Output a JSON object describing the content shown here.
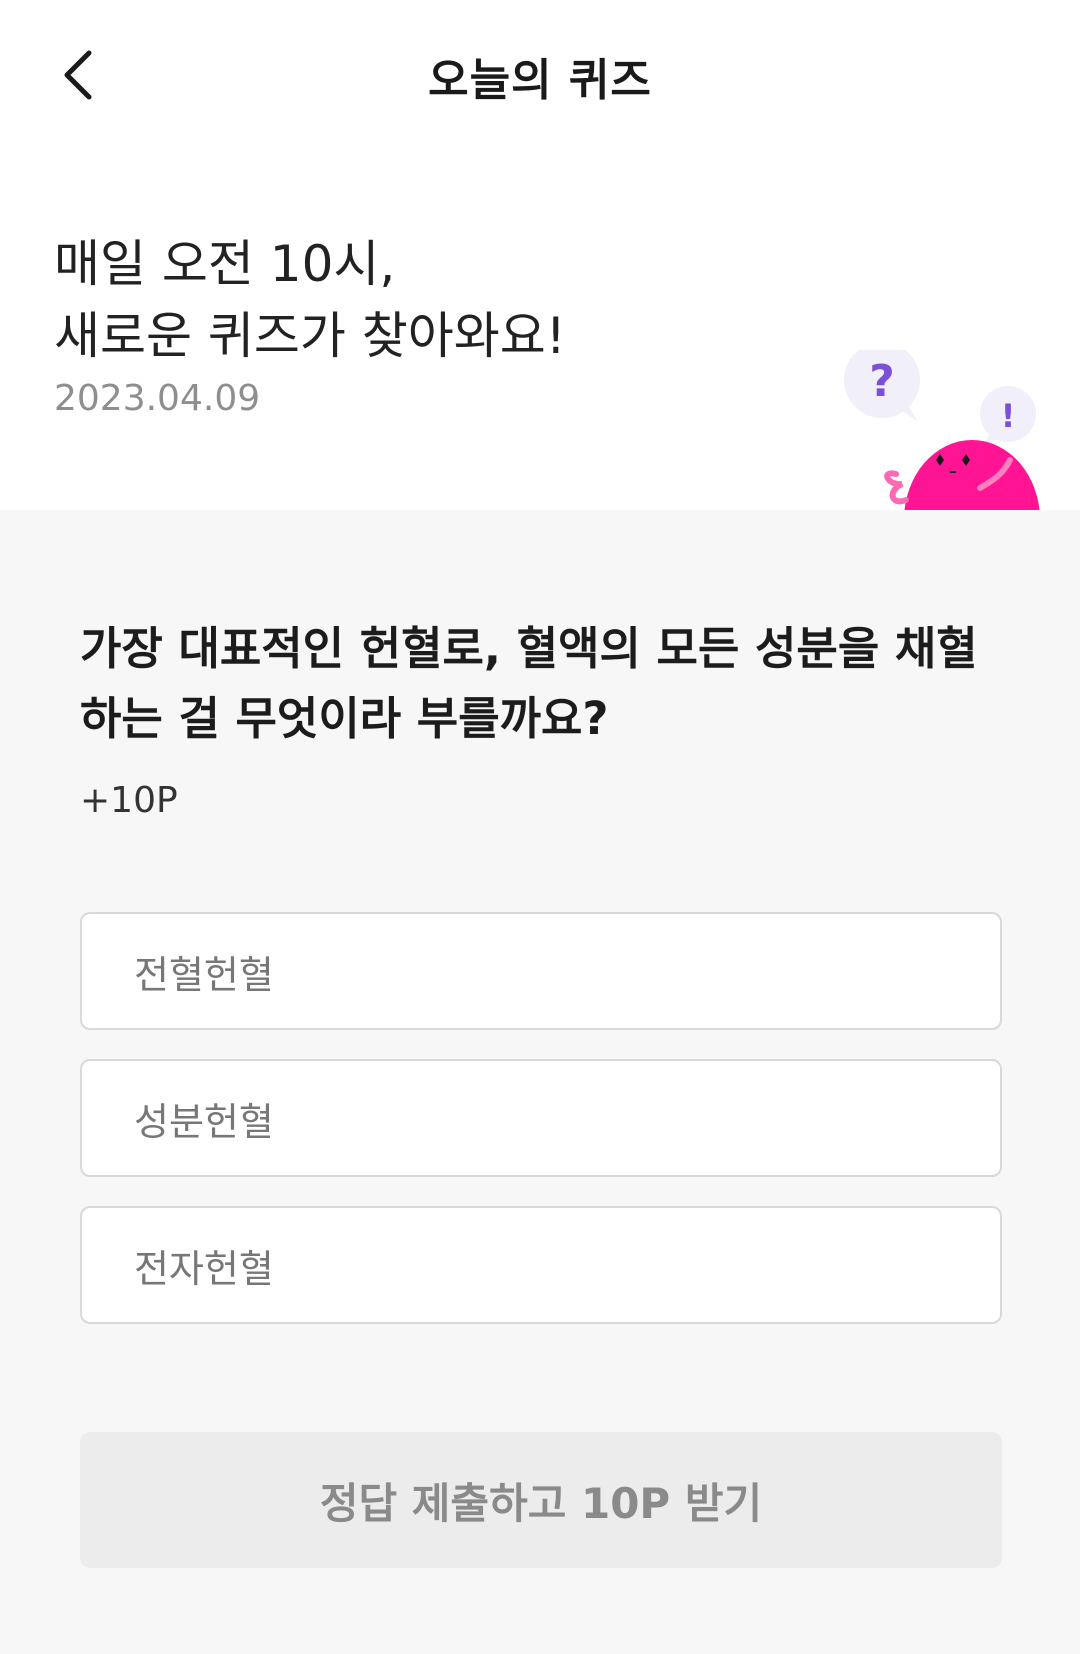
{
  "header": {
    "title": "오늘의 퀴즈",
    "back_icon": "chevron-left-icon"
  },
  "intro": {
    "line1": "매일 오전 10시,",
    "line2": "새로운 퀴즈가 찾아와요!",
    "date": "2023.04.09"
  },
  "mascot": {
    "question_mark": "?",
    "exclamation_mark": "!",
    "accent_color": "#ff1493",
    "bubble_color": "#f1effa",
    "mark_color": "#7b4fd6"
  },
  "quiz": {
    "question_line1": "가장 대표적인 헌혈로, 혈액의 모든 성분을 채혈",
    "question_line2": "하는 걸 무엇이라 부를까요?",
    "points": "+10P",
    "options": [
      {
        "label": "전혈헌혈"
      },
      {
        "label": "성분헌혈"
      },
      {
        "label": "전자헌혈"
      }
    ]
  },
  "submit": {
    "label": "정답 제출하고 10P 받기"
  }
}
